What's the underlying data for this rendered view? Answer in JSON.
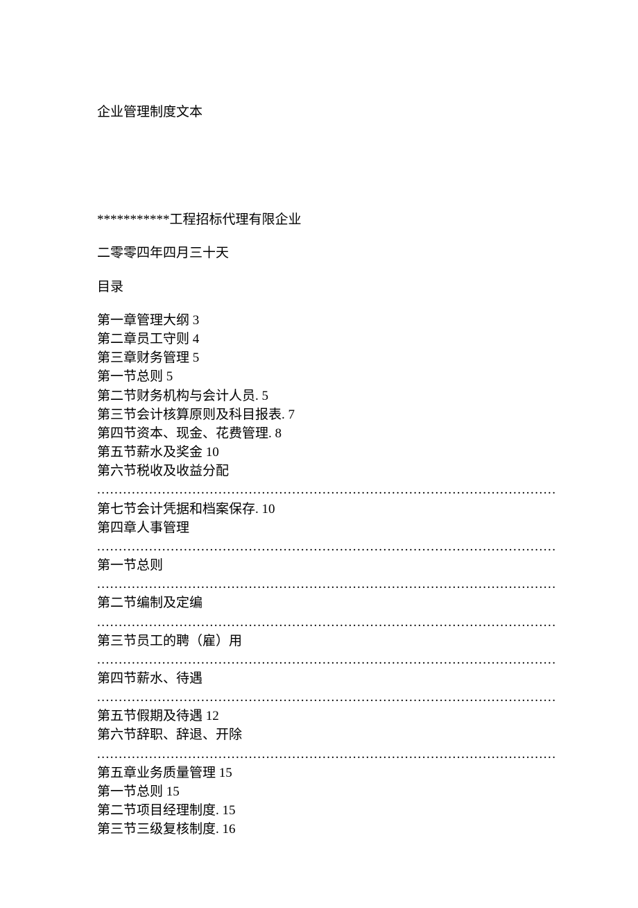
{
  "title": "企业管理制度文本",
  "company": "***********工程招标代理有限企业",
  "date": "二零零四年四月三十天",
  "toc_header": "目录",
  "entries": [
    {
      "text": "第一章管理大纲 3"
    },
    {
      "text": "第二章员工守则 4"
    },
    {
      "text": "第三章财务管理 5"
    },
    {
      "text": "第一节总则 5"
    },
    {
      "text": "第二节财务机构与会计人员. 5"
    },
    {
      "text": "第三节会计核算原则及科目报表. 7"
    },
    {
      "text": "第四节资本、现金、花费管理. 8"
    },
    {
      "text": "第五节薪水及奖金 10"
    },
    {
      "text": "第六节税收及收益分配"
    },
    {
      "dots": true
    },
    {
      "text": "第七节会计凭据和档案保存. 10"
    },
    {
      "text": "第四章人事管理"
    },
    {
      "dots": true
    },
    {
      "text": "第一节总则"
    },
    {
      "dots": true
    },
    {
      "text": "第二节编制及定编"
    },
    {
      "dots": true
    },
    {
      "text": "第三节员工的聘（雇）用"
    },
    {
      "dots": true
    },
    {
      "text": "第四节薪水、待遇"
    },
    {
      "dots": true
    },
    {
      "text": "第五节假期及待遇 12"
    },
    {
      "text": "第六节辞职、辞退、开除"
    },
    {
      "dots": true
    },
    {
      "text": "第五章业务质量管理 15"
    },
    {
      "text": "第一节总则 15"
    },
    {
      "text": "第二节项目经理制度. 15"
    },
    {
      "text": "第三节三级复核制度. 16"
    }
  ]
}
